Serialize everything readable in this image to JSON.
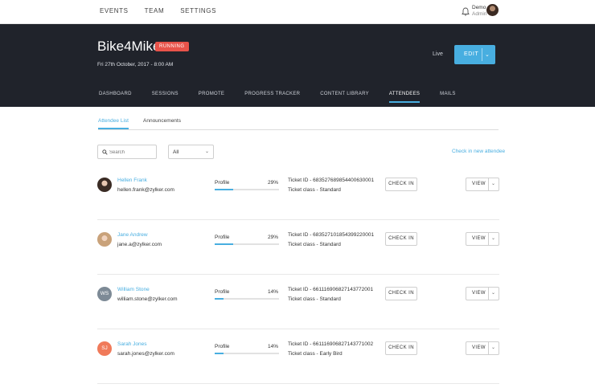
{
  "topnav": {
    "items": [
      "EVENTS",
      "TEAM",
      "SETTINGS"
    ]
  },
  "user": {
    "name": "Demo",
    "role": "Admin"
  },
  "event": {
    "title": "Bike4Mike",
    "status": "RUNNING",
    "date": "Fri 27th October, 2017 - 8:00 AM",
    "live_label": "Live",
    "edit_label": "EDIT"
  },
  "tabs": [
    "DASHBOARD",
    "SESSIONS",
    "PROMOTE",
    "PROGRESS TRACKER",
    "CONTENT LIBRARY",
    "ATTENDEES",
    "MAILS"
  ],
  "active_tab": "ATTENDEES",
  "subtabs": [
    "Attendee List",
    "Announcements"
  ],
  "search": {
    "placeholder": "Search"
  },
  "filter": {
    "selected": "All"
  },
  "checkin_new_label": "Check in new attendee",
  "profile_label": "Profile",
  "checkin_label": "CHECK IN",
  "view_label": "VIEW",
  "attendees": [
    {
      "name": "Hellen Frank",
      "email": "hellen.frank@zylker.com",
      "avatar": "photo",
      "profile_pct": "29%",
      "profile_value": 0.29,
      "ticket": "Ticket ID - 6835276898544006300​01",
      "ticket_class": "Ticket class - Standard"
    },
    {
      "name": "Jane Andrew",
      "email": "jane.a@zylker.com",
      "avatar": "photo",
      "profile_pct": "29%",
      "profile_value": 0.29,
      "ticket": "Ticket ID - 6835271018543992200​01",
      "ticket_class": "Ticket class - Standard"
    },
    {
      "name": "William Stone",
      "email": "william.stone@zylker.com",
      "avatar": "WS",
      "avatar_color": "#7d8a96",
      "profile_pct": "14%",
      "profile_value": 0.14,
      "ticket": "Ticket ID - 6611169068271437720​01",
      "ticket_class": "Ticket class - Standard"
    },
    {
      "name": "Sarah Jones",
      "email": "sarah.jones@zylker.com",
      "avatar": "SJ",
      "avatar_color": "#f07a5a",
      "profile_pct": "14%",
      "profile_value": 0.14,
      "ticket": "Ticket ID - 6611169068271437710​02",
      "ticket_class": "Ticket class - Early Bird"
    }
  ],
  "colors": {
    "accent": "#48aee0",
    "hero_bg": "#20232b",
    "status_badge": "#e8534a"
  }
}
